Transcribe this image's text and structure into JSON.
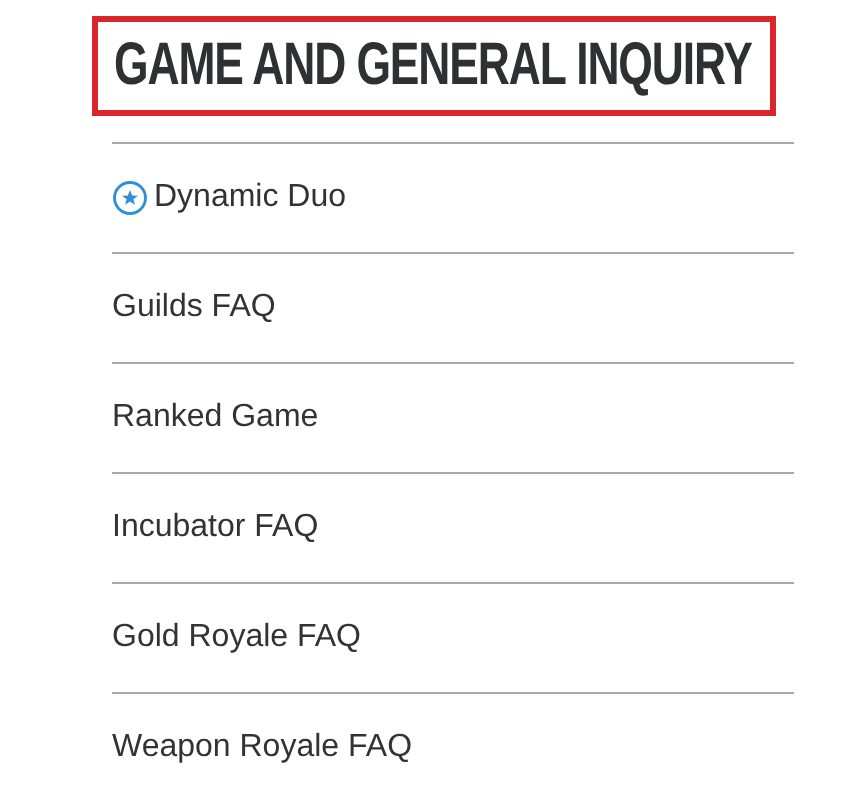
{
  "heading": {
    "title": "GAME AND GENERAL INQUIRY",
    "highlighted": true
  },
  "items": [
    {
      "label": "Dynamic Duo",
      "kind": "starred"
    },
    {
      "label": "Guilds FAQ",
      "kind": "plain"
    },
    {
      "label": "Ranked Game",
      "kind": "plain"
    },
    {
      "label": "Incubator FAQ",
      "kind": "plain"
    },
    {
      "label": "Gold Royale FAQ",
      "kind": "plain"
    },
    {
      "label": "Weapon Royale FAQ",
      "kind": "plain"
    }
  ]
}
